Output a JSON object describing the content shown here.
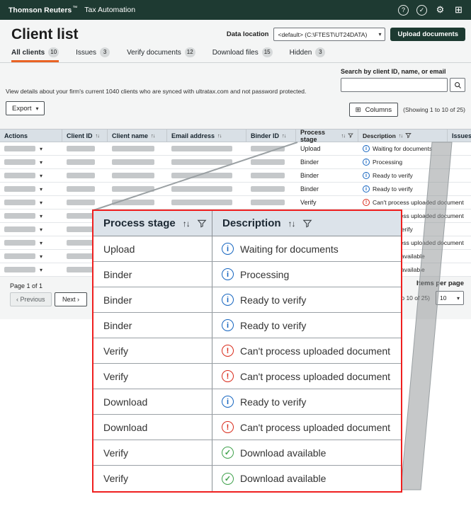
{
  "topbar": {
    "brand": "Thomson Reuters",
    "trademark": "™",
    "app_name": "Tax Automation",
    "icons": [
      {
        "name": "help-icon",
        "glyph": "?"
      },
      {
        "name": "check-icon",
        "glyph": "✓"
      },
      {
        "name": "settings-icon",
        "glyph": "⚙"
      },
      {
        "name": "apps-icon",
        "glyph": "⊞"
      }
    ]
  },
  "header": {
    "title": "Client list",
    "data_location_label": "Data location",
    "data_location_value": "<default> (C:\\FTEST\\UT24DATA)",
    "upload_button_label": "Upload documents"
  },
  "tabs": [
    {
      "label": "All clients",
      "count": "10",
      "active": true
    },
    {
      "label": "Issues",
      "count": "3",
      "active": false
    },
    {
      "label": "Verify documents",
      "count": "12",
      "active": false
    },
    {
      "label": "Download files",
      "count": "15",
      "active": false
    },
    {
      "label": "Hidden",
      "count": "3",
      "active": false
    }
  ],
  "intro": {
    "description": "View details about your firm's current 1040 clients who are synced with ultratax.com and not password protected."
  },
  "search": {
    "label": "Search by client ID, name, or email"
  },
  "toolbar": {
    "export_label": "Export",
    "columns_label": "Columns",
    "showing_text": "(Showing 1 to 10 of 25)"
  },
  "table": {
    "columns": [
      {
        "label": "Actions",
        "sortable": false,
        "filterable": false
      },
      {
        "label": "Client ID",
        "sortable": true,
        "filterable": false
      },
      {
        "label": "Client name",
        "sortable": true,
        "filterable": false
      },
      {
        "label": "Email address",
        "sortable": true,
        "filterable": false
      },
      {
        "label": "Binder ID",
        "sortable": true,
        "filterable": false
      },
      {
        "label": "Process stage",
        "sortable": true,
        "filterable": true
      },
      {
        "label": "Description",
        "sortable": true,
        "filterable": true
      },
      {
        "label": "Issues",
        "sortable": true,
        "filterable": false
      }
    ]
  },
  "rows": [
    {
      "stage": "Upload",
      "icon": "info",
      "description": "Waiting for documents"
    },
    {
      "stage": "Binder",
      "icon": "info",
      "description": "Processing"
    },
    {
      "stage": "Binder",
      "icon": "info",
      "description": "Ready to verify"
    },
    {
      "stage": "Binder",
      "icon": "info",
      "description": "Ready to verify"
    },
    {
      "stage": "Verify",
      "icon": "error",
      "description": "Can't process uploaded document"
    },
    {
      "stage": "Verify",
      "icon": "error",
      "description": "Can't process uploaded document"
    },
    {
      "stage": "Download",
      "icon": "info",
      "description": "Ready to verify"
    },
    {
      "stage": "Download",
      "icon": "error",
      "description": "Can't process uploaded document"
    },
    {
      "stage": "Verify",
      "icon": "success",
      "description": "Download available"
    },
    {
      "stage": "Verify",
      "icon": "success",
      "description": "Download available"
    }
  ],
  "zoom_panel": {
    "process_stage_header": "Process stage",
    "description_header": "Description"
  },
  "pagination": {
    "page_text": "Page 1 of 1",
    "previous_label": "‹ Previous",
    "next_label": "Next ›",
    "items_per_page_label": "Items per page",
    "items_per_page_value": "10",
    "showing_text": "(Showing 1 to 10 of 25)"
  },
  "colors": {
    "topbar_green": "#1e3a32",
    "accent_orange": "#e96325",
    "info_blue": "#1565c0",
    "error_red": "#d92b1b",
    "success_green": "#3fa14b",
    "zoom_border_red": "#ef1f1f",
    "connector_gray": "#9aa0a3"
  }
}
